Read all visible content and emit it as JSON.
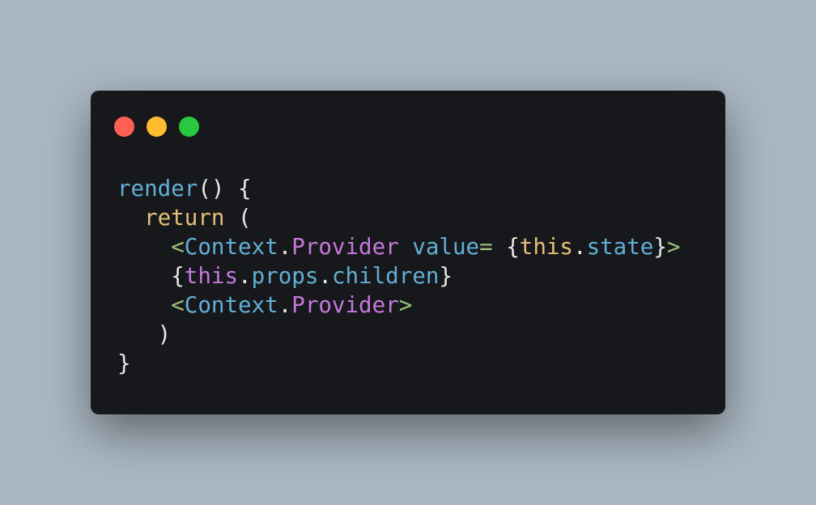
{
  "window_controls": {
    "close_color": "#ff5f57",
    "minimize_color": "#febc2e",
    "zoom_color": "#28c840"
  },
  "colors": {
    "background": "#abb8c3",
    "window": "#17181b",
    "plain": "#e8e8e8",
    "function": "#61afd6",
    "keyword": "#e5c07b",
    "tag_bracket": "#98c379",
    "component": "#c678dd"
  },
  "code": {
    "lines": [
      {
        "indent": "",
        "tokens": [
          {
            "text": "render",
            "role": "function"
          },
          {
            "text": "() {",
            "role": "plain"
          }
        ]
      },
      {
        "indent": "  ",
        "tokens": [
          {
            "text": "return",
            "role": "keyword"
          },
          {
            "text": " (",
            "role": "plain"
          }
        ]
      },
      {
        "indent": "    ",
        "tokens": [
          {
            "text": "<",
            "role": "tag_bracket"
          },
          {
            "text": "Context",
            "role": "function"
          },
          {
            "text": ".",
            "role": "plain"
          },
          {
            "text": "Provider",
            "role": "component"
          },
          {
            "text": " ",
            "role": "plain"
          },
          {
            "text": "value",
            "role": "function"
          },
          {
            "text": "=",
            "role": "tag_bracket"
          },
          {
            "text": " {",
            "role": "plain"
          },
          {
            "text": "this",
            "role": "keyword"
          },
          {
            "text": ".",
            "role": "plain"
          },
          {
            "text": "state",
            "role": "function"
          },
          {
            "text": "}",
            "role": "plain"
          },
          {
            "text": ">",
            "role": "tag_bracket"
          }
        ]
      },
      {
        "indent": "    ",
        "tokens": [
          {
            "text": "{",
            "role": "plain"
          },
          {
            "text": "this",
            "role": "component"
          },
          {
            "text": ".",
            "role": "plain"
          },
          {
            "text": "props",
            "role": "function"
          },
          {
            "text": ".",
            "role": "plain"
          },
          {
            "text": "children",
            "role": "function"
          },
          {
            "text": "}",
            "role": "plain"
          }
        ]
      },
      {
        "indent": "    ",
        "tokens": [
          {
            "text": "<",
            "role": "tag_bracket"
          },
          {
            "text": "Context",
            "role": "function"
          },
          {
            "text": ".",
            "role": "plain"
          },
          {
            "text": "Provider",
            "role": "component"
          },
          {
            "text": ">",
            "role": "tag_bracket"
          }
        ]
      },
      {
        "indent": "   ",
        "tokens": [
          {
            "text": ")",
            "role": "plain"
          }
        ]
      },
      {
        "indent": "",
        "tokens": [
          {
            "text": "}",
            "role": "plain"
          }
        ]
      }
    ]
  }
}
